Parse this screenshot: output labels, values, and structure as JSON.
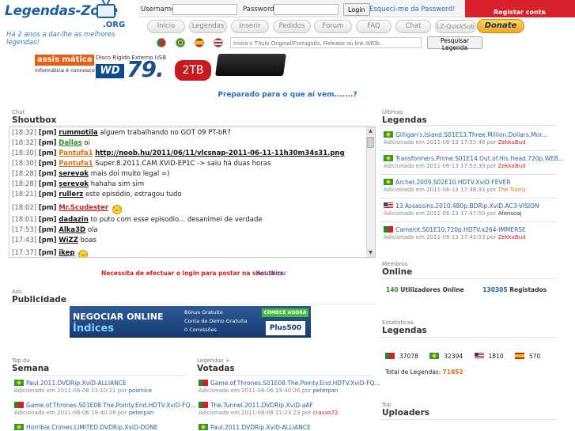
{
  "logo": {
    "title": "Legendas-Zone",
    "tld": ".ORG",
    "tagline": "Há 2 anos a dar-lhe as melhores legendas!"
  },
  "login": {
    "username_label": "Username:",
    "password_label": "Password:",
    "login_button": "Login",
    "forgot": "Esqueci-me da Password!",
    "register": "Registar conta"
  },
  "nav": {
    "tabs": [
      "Início",
      "Legendas",
      "Inserir",
      "Pedidos",
      "Forum",
      "FAQ",
      "Chat",
      "LZ-QuickSub"
    ],
    "donate": "Donate"
  },
  "search": {
    "placeholder": "Insira o Título Original/Português, Release ou link IMDb.",
    "button": "Pesquisar Legenda"
  },
  "banner": {
    "brand": "assis mática",
    "brand_sub": "informática é connosco",
    "product": "Disco Rígido Externo USB",
    "wd": "WD",
    "number": "79.",
    "capacity": "2TB"
  },
  "ready_text": "Preparado para o que aí vem.......?",
  "shoutbox": {
    "small": "Chat",
    "title": "Shoutbox",
    "messages": [
      {
        "time": "[18:32]",
        "pm": "[pm]",
        "user": "rummotila",
        "text": " alguem trabalhando no GOT 09 PT-bR?"
      },
      {
        "time": "[18:32]",
        "pm": "[pm]",
        "user": "Dallas",
        "text": " oi"
      },
      {
        "time": "[18:30]",
        "pm": "[pm]",
        "user": "Pantufa1",
        "text": "http://noob.hu/2011/06/11/vlcsnap-2011-06-11-11h30m34s31.png"
      },
      {
        "time": "[18:30]",
        "pm": "[pm]",
        "user": "Pantufa1",
        "text": " Super.8.2011.CAM.XViD-EP1C -> saiu há duas horas"
      },
      {
        "time": "[18:28]",
        "pm": "[pm]",
        "user": "serevok",
        "text": " mais doi muito legal =)"
      },
      {
        "time": "[18:28]",
        "pm": "[pm]",
        "user": "serevok",
        "text": " hahaha sim sim"
      },
      {
        "time": "[18:21]",
        "pm": "[pm]",
        "user": "rullerz",
        "text": " este episódio, estragou tudo"
      },
      {
        "time": "[18:02]",
        "pm": "[pm]",
        "user": "Mr.Scudester",
        "text": ""
      },
      {
        "time": "[18:01]",
        "pm": "[pm]",
        "user": "dadazin",
        "text": " to puto com esse episodio... desanimei de verdade"
      },
      {
        "time": "[17:53]",
        "pm": "[pm]",
        "user": "Alka3D",
        "text": " ola"
      },
      {
        "time": "[17:43]",
        "pm": "[pm]",
        "user": "WiZZ",
        "text": " boas"
      },
      {
        "time": "[17:37]",
        "pm": "[pm]",
        "user": "ikep",
        "text": ""
      }
    ],
    "login_note": "Necessita de efectuar o login para postar na shoutbox.",
    "refresh": "Actualizar"
  },
  "ads": {
    "small": "Ads",
    "title": "Publicidade",
    "line1": "NEGOCIAR ONLINE",
    "line2": "Índices",
    "bullets": [
      "Bónus Gratuito",
      "Conta de Demo Gratuita",
      "0 Comissões"
    ],
    "cta": "COMECE AGORA",
    "brand": "Plus500"
  },
  "top_week": {
    "small": "Top da",
    "title": "Semana",
    "items": [
      {
        "title": "Paul.2011.DVDRip.XviD-ALLIANCE",
        "meta": "Adicionado em 2011-06-08 13:10:21 por",
        "user": "polenice"
      },
      {
        "title": "Game.of.Thrones.S01E08.The.Pointy.End.HDTV.XviD-FQ...",
        "meta": "Adicionado em 2011-06-06 19:40:28 por",
        "user": "peterpan"
      },
      {
        "title": "Horrible.Crimes.LIMITED.DVDRip.XviD-DONE",
        "meta": "",
        "user": ""
      }
    ]
  },
  "top_voted": {
    "small": "Legendas +",
    "title": "Votadas",
    "items": [
      {
        "title": "Game.of.Thrones.S01E08.The.Pointy.End.HDTV.XviD-FQ...",
        "meta": "Adicionado em 2011-06-06 19:40:28 por",
        "user": "peterpan"
      },
      {
        "title": "The.Tunnel.2011.DVDRip.XviD-aAF",
        "meta": "Adicionado em 2011-06-08 21:23:23 por",
        "user": "cravas72"
      },
      {
        "title": "Paul.2011.DVDRip.XviD-ALLIANCE",
        "meta": "",
        "user": ""
      }
    ]
  },
  "latest": {
    "small": "Últimas",
    "title": "Legendas",
    "items": [
      {
        "flag": "br",
        "title": "Gilligan's.Island.S01E13.Three.Million.Dollars.Mor...",
        "meta": "Adicionado em 2011-06-13 17:55:48 por",
        "user": "ZekkaBud"
      },
      {
        "flag": "br",
        "title": "Transformers.Prime.S01E14.Out.of.His.Head.720p.WEB...",
        "meta": "Adicionado em 2011-06-13 17:53:39 por",
        "user": "ZekkaBud"
      },
      {
        "flag": "br",
        "title": "Archer.2009.S02E10.HDTV.XviD-FEVER",
        "meta": "Adicionado em 2011-06-13 17:48:33 por",
        "user": "The Tuonz"
      },
      {
        "flag": "us",
        "title": "13.Assassins.2010.480p.BDRip.XviD.AC3-VISION",
        "meta": "Adicionado em 2011-06-13 17:47:50 por",
        "user": "Afonsoaj"
      },
      {
        "flag": "pt",
        "title": "Camelot.S01E10.720p.HDTV.x264-IMMERSE",
        "meta": "Adicionado em 2011-06-13 17:43:53 por",
        "user": "ZekkaBud"
      }
    ]
  },
  "members": {
    "small": "Membros",
    "title": "Online",
    "online_count": "140",
    "online_label": "Utilizadores Online",
    "registered_count": "130305",
    "registered_label": "Registados"
  },
  "stats": {
    "small": "Estatísticas",
    "title": "Legendas",
    "pt": "37078",
    "br": "32394",
    "us": "1810",
    "es": "570",
    "total_label": "Total de Legendas:",
    "total": "71852"
  },
  "uploaders": {
    "small": "Top",
    "title": "Uploaders"
  }
}
